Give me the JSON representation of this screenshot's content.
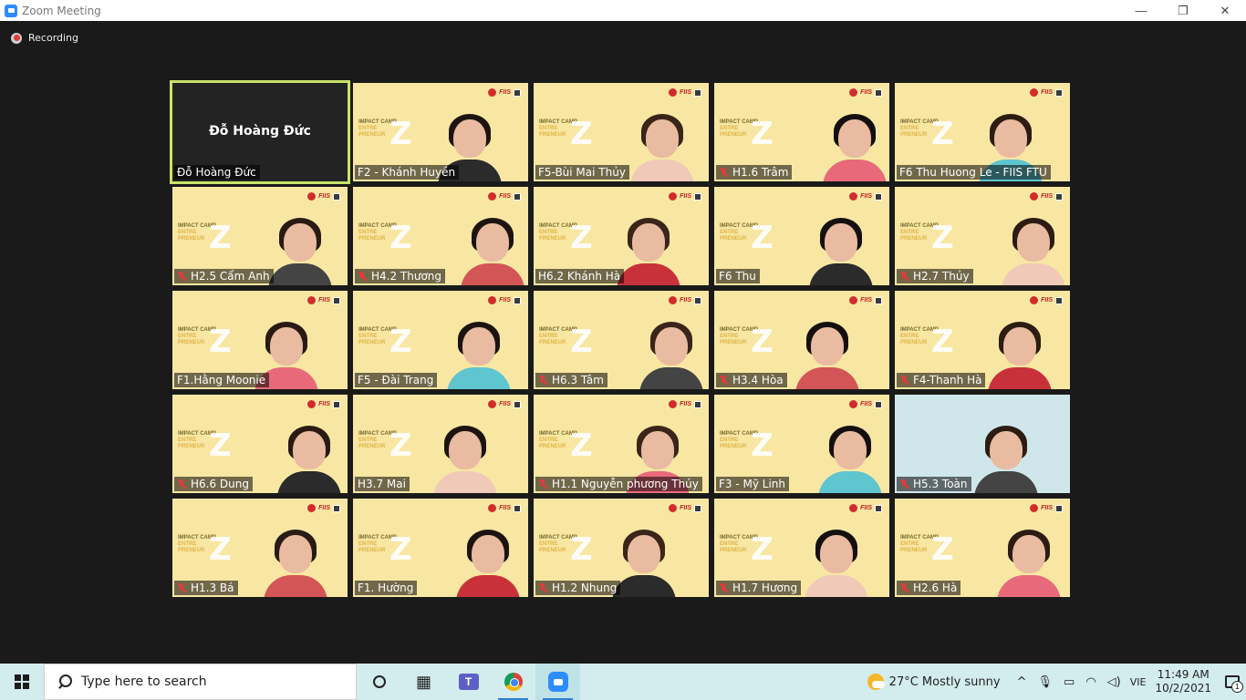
{
  "window": {
    "title": "Zoom Meeting",
    "minimize": "—",
    "restore": "❐",
    "close": "✕"
  },
  "recording": {
    "label": "Recording"
  },
  "branding": {
    "camp_line1": "IMPACT CAMP",
    "camp_line2": "ENTRE",
    "camp_line3": "PRENEUR",
    "z": "Z",
    "logo": "FIIS"
  },
  "participants": [
    {
      "name": "Đỗ Hoàng Đức",
      "muted": false,
      "video": false
    },
    {
      "name": "F2 - Khánh Huyền",
      "muted": false,
      "video": true
    },
    {
      "name": "F5-Bùi Mai Thủy",
      "muted": false,
      "video": true
    },
    {
      "name": "H1.6 Trâm",
      "muted": true,
      "video": true
    },
    {
      "name": "F6 Thu Huong Le - FIIS FTU",
      "muted": false,
      "video": true
    },
    {
      "name": "H2.5 Cẩm Anh",
      "muted": true,
      "video": true
    },
    {
      "name": "H4.2 Thương",
      "muted": true,
      "video": true
    },
    {
      "name": "H6.2 Khánh Hà",
      "muted": false,
      "video": true
    },
    {
      "name": "F6 Thu",
      "muted": false,
      "video": true
    },
    {
      "name": "H2.7 Thủy",
      "muted": true,
      "video": true
    },
    {
      "name": "F1.Hằng Moonie",
      "muted": false,
      "video": true
    },
    {
      "name": "F5 - Đài Trang",
      "muted": false,
      "video": true
    },
    {
      "name": "H6.3 Tâm",
      "muted": true,
      "video": true
    },
    {
      "name": "H3.4 Hòa",
      "muted": true,
      "video": true
    },
    {
      "name": "F4-Thanh Hà",
      "muted": true,
      "video": true
    },
    {
      "name": "H6.6 Dung",
      "muted": true,
      "video": true
    },
    {
      "name": "H3.7 Mai",
      "muted": false,
      "video": true
    },
    {
      "name": "H1.1 Nguyễn phương Thúy",
      "muted": true,
      "video": true
    },
    {
      "name": "F3 - Mỹ Linh",
      "muted": false,
      "video": true
    },
    {
      "name": "H5.3 Toàn",
      "muted": true,
      "video": true
    },
    {
      "name": "H1.3 Bá",
      "muted": true,
      "video": true
    },
    {
      "name": "F1. Hường",
      "muted": false,
      "video": true
    },
    {
      "name": "H1.2 Nhung",
      "muted": true,
      "video": true
    },
    {
      "name": "H1.7 Hương",
      "muted": true,
      "video": true
    },
    {
      "name": "H2.6 Hà",
      "muted": true,
      "video": true
    }
  ],
  "taskbar": {
    "search_placeholder": "Type here to search",
    "weather": "27°C  Mostly sunny",
    "tray_chevron": "^",
    "language": "VIE",
    "time": "11:49 AM",
    "date": "10/2/2021",
    "notification_count": "1"
  }
}
